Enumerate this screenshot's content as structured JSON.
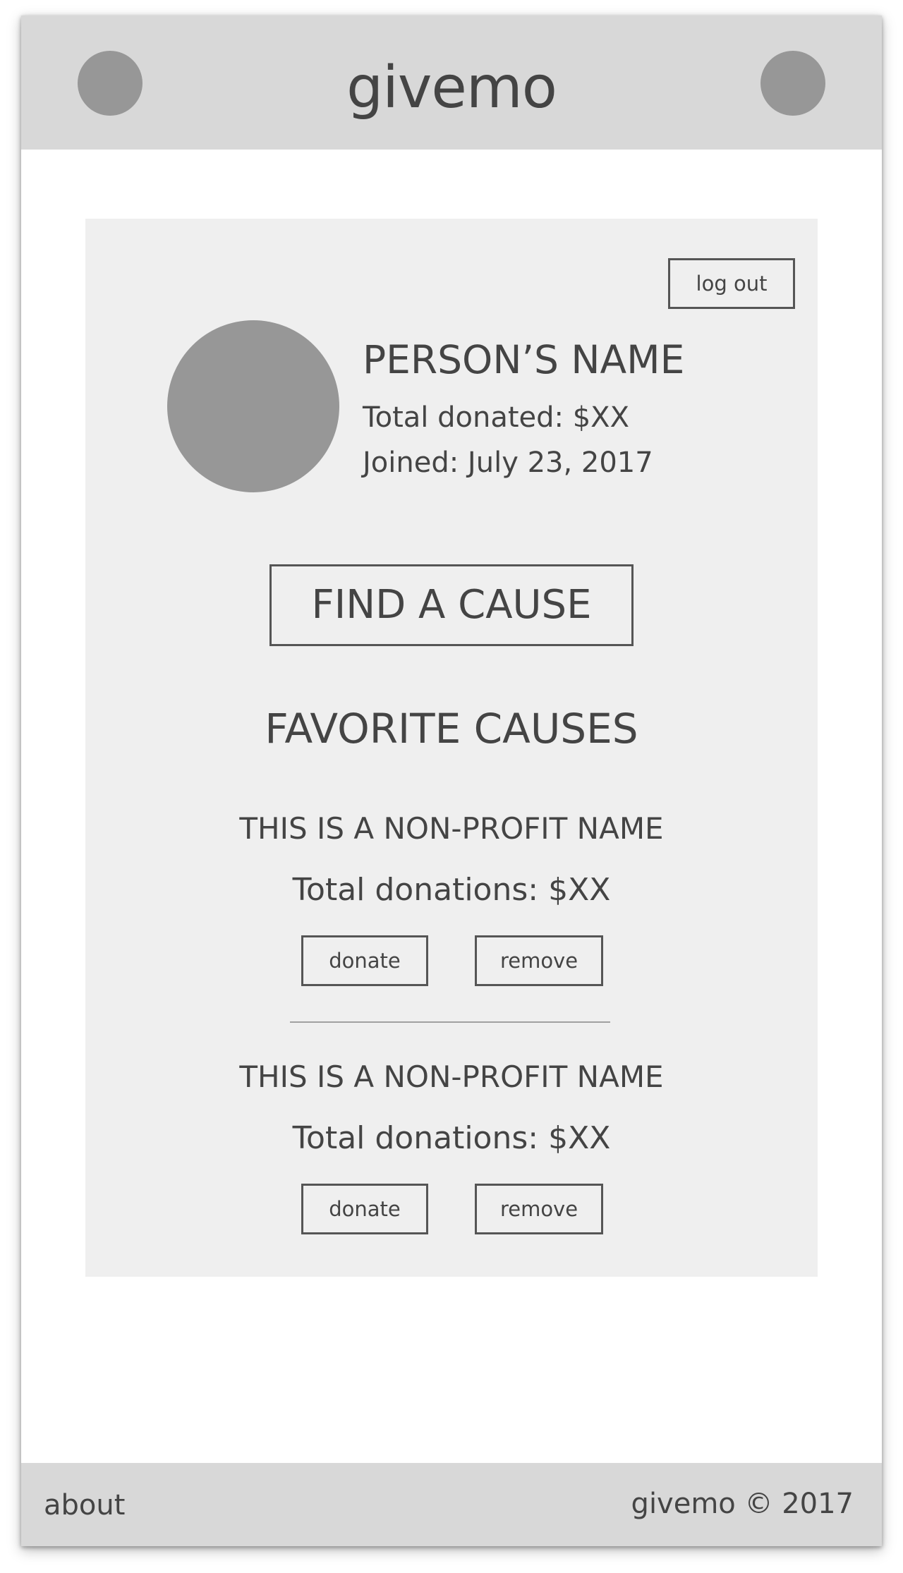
{
  "header": {
    "title": "givemo",
    "left_button_icon": "menu-icon",
    "right_button_icon": "account-icon"
  },
  "profile": {
    "logout_label": "log out",
    "avatar_icon": "avatar-placeholder",
    "name": "PERSON’S NAME",
    "total_donated": "Total donated: $XX",
    "joined": "Joined: July 23, 2017"
  },
  "find_cause_label": "FIND A CAUSE",
  "favorites": {
    "heading": "FAVORITE CAUSES",
    "items": [
      {
        "name": "THIS IS A NON-PROFIT NAME",
        "total": "Total donations: $XX",
        "donate_label": "donate",
        "remove_label": "remove"
      },
      {
        "name": "THIS IS A NON-PROFIT NAME",
        "total": "Total donations: $XX",
        "donate_label": "donate",
        "remove_label": "remove"
      }
    ]
  },
  "footer": {
    "about_label": "about",
    "copyright": "givemo © 2017"
  },
  "colors": {
    "bar_background": "#d8d8d8",
    "card_background": "#efefef",
    "placeholder_gray": "#979797",
    "text": "#444444"
  }
}
